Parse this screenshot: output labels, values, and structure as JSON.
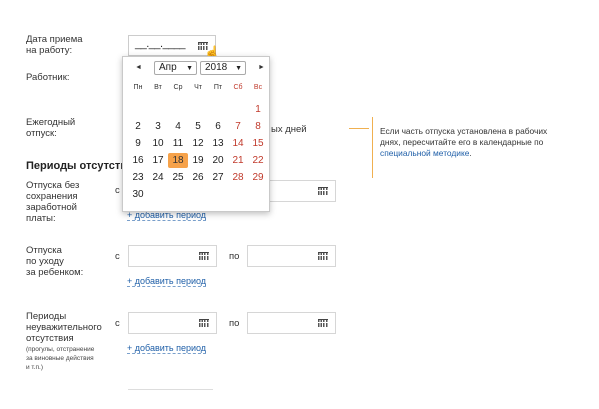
{
  "hire_date": {
    "label_line1": "Дата приема",
    "label_line2": "на работу:",
    "mask": "__.__.____"
  },
  "employee": {
    "label": "Работник:"
  },
  "vacation": {
    "label_line1": "Ежегодный",
    "label_line2": "отпуск:",
    "days_suffix": "ых дней"
  },
  "section_title": "Периоды отсутстви",
  "calendar": {
    "prev": "◄",
    "next": "►",
    "month": "Апр",
    "year": "2018",
    "weekdays": [
      "Пн",
      "Вт",
      "Ср",
      "Чт",
      "Пт",
      "Сб",
      "Вс"
    ],
    "weeks": [
      [
        "",
        "",
        "",
        "",
        "",
        "",
        "1"
      ],
      [
        "2",
        "3",
        "4",
        "5",
        "6",
        "7",
        "8"
      ],
      [
        "9",
        "10",
        "11",
        "12",
        "13",
        "14",
        "15"
      ],
      [
        "16",
        "17",
        "18",
        "19",
        "20",
        "21",
        "22"
      ],
      [
        "23",
        "24",
        "25",
        "26",
        "27",
        "28",
        "29"
      ],
      [
        "30",
        "",
        "",
        "",
        "",
        "",
        ""
      ]
    ],
    "today": "18"
  },
  "unpaid": {
    "lines": [
      "Отпуска без",
      "сохранения",
      "заработной",
      "платы:"
    ],
    "from": "с",
    "add_link": "+ добавить период"
  },
  "childcare": {
    "lines": [
      "Отпуска",
      "по уходу",
      "за ребенком:"
    ],
    "from": "с",
    "to": "по",
    "add_link": "+ добавить период"
  },
  "absence": {
    "lines": [
      "Периоды",
      "неуважительного",
      "отсутствия"
    ],
    "note_lines": [
      "(прогулы, отстранение",
      "за виновные действия",
      "и т.п.)"
    ],
    "from": "с",
    "to": "по",
    "add_link": "+ добавить период"
  },
  "tooltip": {
    "text1": "Если часть отпуска установлена в рабочих днях, пересчитайте его в календарные по ",
    "link": "специальной методике",
    "text2": "."
  },
  "colors": {
    "weekend": "#c0392b",
    "today": "#f6a24a",
    "link": "#1f5fa8",
    "tip_line": "#f0b050"
  }
}
